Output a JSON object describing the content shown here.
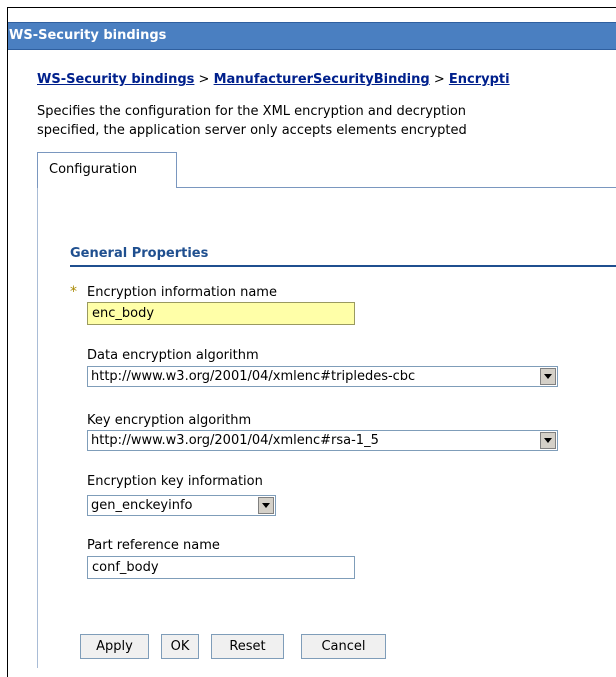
{
  "window": {
    "title": "WS-Security bindings"
  },
  "breadcrumb": {
    "items": [
      "WS-Security bindings",
      "ManufacturerSecurityBinding",
      "Encrypti"
    ],
    "separator": ">"
  },
  "description": {
    "line1": "Specifies the configuration for the XML encryption and decryption",
    "line2": "specified, the application server only accepts elements encrypted"
  },
  "tabs": [
    {
      "label": "Configuration",
      "active": true
    }
  ],
  "section": {
    "title": "General Properties"
  },
  "form": {
    "required_marker": "*",
    "encryption_info_name": {
      "label": "Encryption information name",
      "value": "enc_body",
      "required": true
    },
    "data_encryption_algorithm": {
      "label": "Data encryption algorithm",
      "value": "http://www.w3.org/2001/04/xmlenc#tripledes-cbc"
    },
    "key_encryption_algorithm": {
      "label": "Key encryption algorithm",
      "value": "http://www.w3.org/2001/04/xmlenc#rsa-1_5"
    },
    "encryption_key_information": {
      "label": "Encryption key information",
      "value": "gen_enckeyinfo"
    },
    "part_reference_name": {
      "label": "Part reference name",
      "value": "conf_body"
    }
  },
  "buttons": {
    "apply": "Apply",
    "ok": "OK",
    "reset": "Reset",
    "cancel": "Cancel"
  },
  "colors": {
    "titlebar": "#4a7fc1",
    "link": "#00208c",
    "section": "#1f4f8f",
    "required_field": "#ffffa8"
  },
  "icons": {
    "dropdown": "chevron-down-icon",
    "required": "asterisk-icon"
  }
}
